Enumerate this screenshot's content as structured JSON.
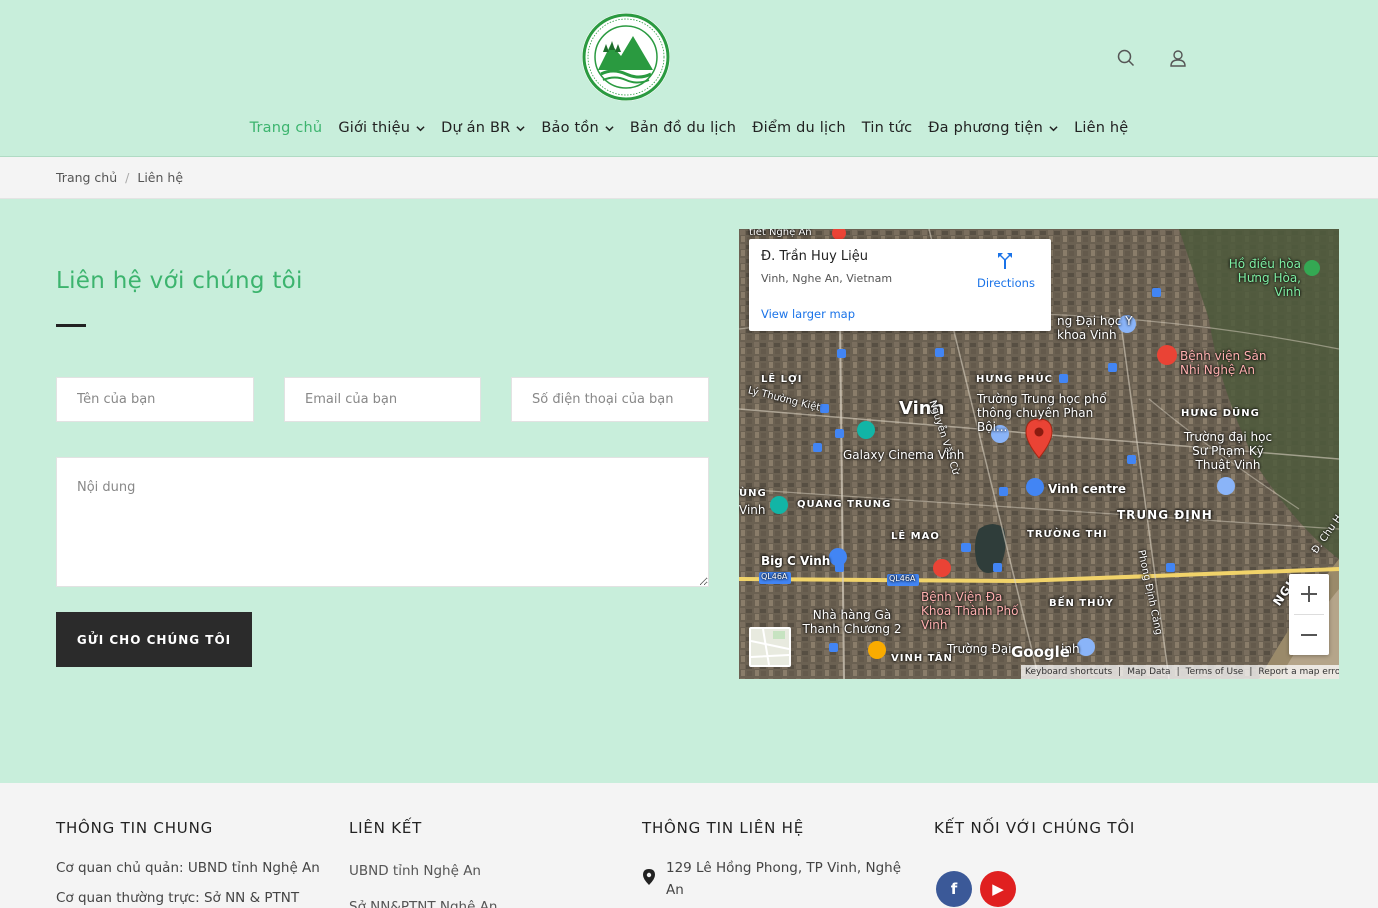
{
  "header": {
    "nav": [
      {
        "label": "Trang chủ",
        "active": true,
        "dropdown": false
      },
      {
        "label": "Giới thiệu",
        "active": false,
        "dropdown": true
      },
      {
        "label": "Dự án BR",
        "active": false,
        "dropdown": true
      },
      {
        "label": "Bảo tồn",
        "active": false,
        "dropdown": true
      },
      {
        "label": "Bản đồ du lịch",
        "active": false,
        "dropdown": false
      },
      {
        "label": "Điểm du lịch",
        "active": false,
        "dropdown": false
      },
      {
        "label": "Tin tức",
        "active": false,
        "dropdown": false
      },
      {
        "label": "Đa phương tiện",
        "active": false,
        "dropdown": true
      },
      {
        "label": "Liên hệ",
        "active": false,
        "dropdown": false
      }
    ],
    "icons": [
      "search-icon",
      "user-icon"
    ]
  },
  "breadcrumb": {
    "home": "Trang chủ",
    "current": "Liên hệ"
  },
  "contact": {
    "title": "Liên hệ với chúng tôi",
    "name_placeholder": "Tên của bạn",
    "email_placeholder": "Email của bạn",
    "phone_placeholder": "Số điện thoại của bạn",
    "message_placeholder": "Nội dung",
    "submit_label": "GỬI CHO CHÚNG TÔI"
  },
  "map": {
    "info_title": "Đ. Trần Huy Liệu",
    "info_subtitle": "Vinh, Nghe An, Vietnam",
    "view_larger": "View larger map",
    "directions": "Directions",
    "labels": {
      "city": "Vinh",
      "galaxy": "Galaxy Cinema Vinh",
      "vinh_centre": "Vinh centre",
      "trung_dinh": "TRUNG ĐỊNH",
      "big_c": "Big C Vinh",
      "bv_daikhoa": "Bệnh Viện Đa Khoa Thành Phố Vinh",
      "nha_hang": "Nhà hàng Gà Thanh Chương 2",
      "ho_dieu_hoa": "Hồ điều hòa Hưng Hòa, Vinh",
      "bv_san": "Bệnh viện Sản Nhi Nghệ An",
      "thpt_phan_boi": "Trường Trung học phổ thông chuyên Phan Bội...",
      "dh_spkt": "Trường đại học Sư Phạm Kỹ Thuật Vinh",
      "dh_ykhoa": "ng Đại học Y khoa Vinh",
      "hung_phuc": "HƯNG PHÚC",
      "hung_dung": "HƯNG DŨNG",
      "le_loi": "LÊ LỢI",
      "quang_trung": "QUANG TRUNG",
      "le_mao": "LÊ MAO",
      "truong_thi": "TRƯỜNG THI",
      "ben_thuy": "BẾN THỦY",
      "vinh_tan": "VINH TÂN",
      "truong_dai": "Trường Đại",
      "inh": "inh",
      "ung": "ÙNG",
      "vinh_left": "Vinh",
      "top_label": "tiết Nghệ An",
      "ly_thuong_kiet": "Lý Thường Kiệt",
      "nguyen_van_cu": "Nguyễn Văn Cừ",
      "phong_dinh_cang": "Phong Định Cảng",
      "ql46a_1": "QL46A",
      "ql46a_2": "QL46A",
      "ngh": "NGH",
      "d_chu": "Đ. Chu H"
    },
    "google": "Google",
    "footer": [
      "Keyboard shortcuts",
      "Map Data",
      "Terms of Use",
      "Report a map error"
    ]
  },
  "footer": {
    "col1_title": "THÔNG TIN CHUNG",
    "col1_line1": "Cơ quan chủ quản: UBND tỉnh Nghệ An",
    "col1_line2": "Cơ quan thường trực: Sở NN & PTNT",
    "col2_title": "LIÊN KẾT",
    "col2_link1": "UBND tỉnh Nghệ An",
    "col2_link2": "Sở NN&PTNT Nghệ An",
    "col3_title": "THÔNG TIN LIÊN HỆ",
    "col3_addr1": "129 Lê Hồng Phong, TP Vinh, Nghệ",
    "col3_addr2": "An",
    "col4_title": "KẾT NỐI VỚI CHÚNG TÔI",
    "social": [
      {
        "icon": "facebook-icon",
        "glyph": "f",
        "color": "#3b5998"
      },
      {
        "icon": "youtube-icon",
        "glyph": "▶",
        "color": "#e02020"
      }
    ]
  },
  "colors": {
    "accent": "#3cb46e",
    "header_bg": "#c8eedb",
    "button_dark": "#2b2b2b"
  }
}
